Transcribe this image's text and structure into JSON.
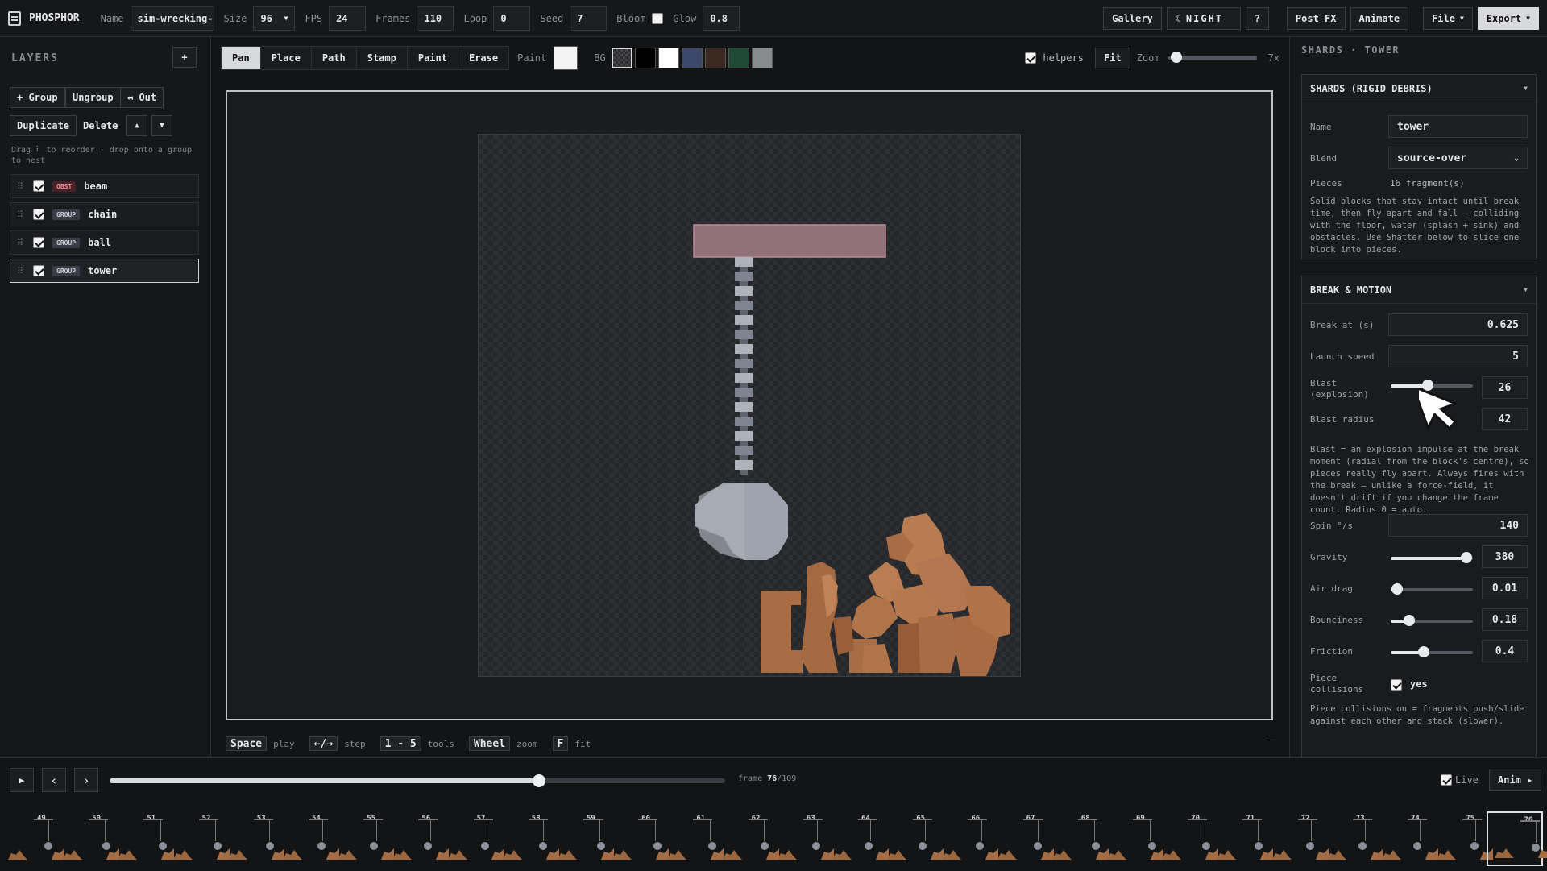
{
  "app": {
    "name": "PHOSPHOR"
  },
  "topbar": {
    "name_label": "Name",
    "name_value": "sim-wrecking-",
    "size_label": "Size",
    "size_value": "96",
    "fps_label": "FPS",
    "fps_value": "24",
    "frames_label": "Frames",
    "frames_value": "110",
    "loop_label": "Loop",
    "loop_value": "0",
    "seed_label": "Seed",
    "seed_value": "7",
    "bloom_label": "Bloom",
    "bloom_checked": false,
    "glow_label": "Glow",
    "glow_value": "0.8",
    "gallery": "Gallery",
    "night": "NIGHT",
    "help": "?",
    "postfx": "Post FX",
    "animate": "Animate",
    "file": "File",
    "export": "Export"
  },
  "layers_panel": {
    "title": "LAYERS",
    "add": "+",
    "group_btn": "+ Group",
    "ungroup_btn": "Ungroup",
    "out_btn": "↤ Out",
    "duplicate_btn": "Duplicate",
    "delete_btn": "Delete",
    "up_btn": "▲",
    "down_btn": "▼",
    "hint": "Drag ⠇ to reorder · drop onto a group to nest",
    "items": [
      {
        "tag": "OBST",
        "name": "beam",
        "visible": true,
        "selected": false
      },
      {
        "tag": "GROUP",
        "name": "chain",
        "visible": true,
        "selected": false
      },
      {
        "tag": "GROUP",
        "name": "ball",
        "visible": true,
        "selected": false
      },
      {
        "tag": "GROUP",
        "name": "tower",
        "visible": true,
        "selected": true
      }
    ]
  },
  "tools": {
    "items": [
      "Pan",
      "Place",
      "Path",
      "Stamp",
      "Paint",
      "Erase"
    ],
    "active": "Pan",
    "paint_label": "Paint",
    "paint_color": "#f4f4f4",
    "bg_label": "BG",
    "bg_swatches": [
      "#2a2c30",
      "#000000",
      "#ffffff",
      "#3b4a6b",
      "#3a2a20",
      "#1f4a33",
      "#8a8b8e"
    ],
    "helpers_label": "helpers",
    "helpers_checked": true,
    "fit": "Fit",
    "zoom_label": "Zoom",
    "zoom_value": "7x",
    "zoom_fraction": 0.04
  },
  "keyhints": [
    {
      "key": "Space",
      "desc": "play"
    },
    {
      "key": "←/→",
      "desc": "step"
    },
    {
      "key": "1 - 5",
      "desc": "tools"
    },
    {
      "key": "Wheel",
      "desc": "zoom"
    },
    {
      "key": "F",
      "desc": "fit"
    }
  ],
  "inspector": {
    "crumb": "SHARDS · TOWER",
    "section1": {
      "title": "SHARDS (RIGID DEBRIS)",
      "name_label": "Name",
      "name_value": "tower",
      "blend_label": "Blend",
      "blend_value": "source-over",
      "pieces_label": "Pieces",
      "pieces_value": "16 fragment(s)",
      "desc": "Solid blocks that stay intact until break time, then fly apart and fall — colliding with the floor, water (splash + sink) and obstacles. Use Shatter below to slice one block into pieces."
    },
    "section2": {
      "title": "BREAK & MOTION",
      "break_label": "Break at (s)",
      "break_value": "0.625",
      "launch_label": "Launch speed",
      "launch_value": "5",
      "blast_label": "Blast (explosion)",
      "blast_value": "26",
      "blast_fraction": 0.45,
      "radius_label": "Blast radius",
      "radius_value": "42",
      "blast_desc": "Blast = an explosion impulse at the break moment (radial from the block's centre), so pieces really fly apart. Always fires with the break — unlike a force-field, it doesn't drift if you change the frame count. Radius 0 = auto.",
      "spin_label": "Spin °/s",
      "spin_value": "140",
      "gravity_label": "Gravity",
      "gravity_value": "380",
      "gravity_fraction": 0.92,
      "drag_label": "Air drag",
      "drag_value": "0.01",
      "drag_fraction": 0.08,
      "bounce_label": "Bounciness",
      "bounce_value": "0.18",
      "bounce_fraction": 0.23,
      "friction_label": "Friction",
      "friction_value": "0.4",
      "friction_fraction": 0.4,
      "collisions_label": "Piece collisions",
      "collisions_value": "yes",
      "collisions_checked": true,
      "collisions_desc": "Piece collisions on = fragments push/slide against each other and stack (slower)."
    }
  },
  "timeline": {
    "play": "▶",
    "prev": "‹",
    "next": "›",
    "frame_label": "frame",
    "frame_current": "76",
    "frame_total": "109",
    "progress": 0.697,
    "live_label": "Live",
    "live_checked": true,
    "anim": "Anim ▸",
    "thumb_frames": [
      "49",
      "50",
      "51",
      "52",
      "53",
      "54",
      "55",
      "56",
      "57",
      "58",
      "59",
      "60",
      "61",
      "62",
      "63",
      "64",
      "65",
      "66",
      "67",
      "68",
      "69",
      "70",
      "71",
      "72",
      "73",
      "74",
      "75",
      "76"
    ]
  },
  "colors": {
    "beam": "#a07e88",
    "chain": "#a7acb5",
    "ball": "#9ea3ad",
    "debris": "#b0764a",
    "debris_dark": "#8a5634"
  }
}
